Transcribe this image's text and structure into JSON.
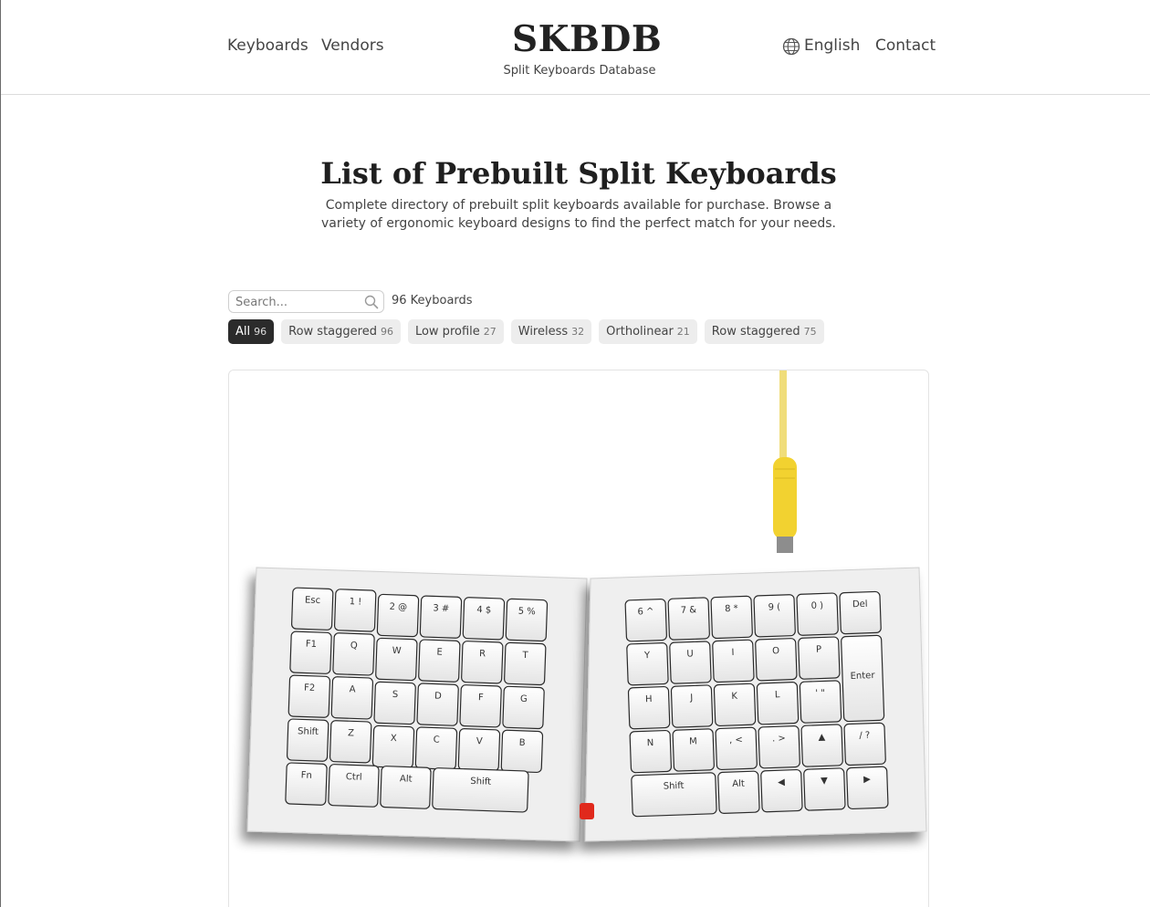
{
  "nav": {
    "keyboards": "Keyboards",
    "vendors": "Vendors",
    "language": "English",
    "contact": "Contact"
  },
  "brand": {
    "name": "SKBDB",
    "tagline": "Split Keyboards Database"
  },
  "page": {
    "title": "List of Prebuilt Split Keyboards",
    "description": "Complete directory of prebuilt split keyboards available for purchase. Browse a variety of ergonomic keyboard designs to find the perfect match for your needs."
  },
  "search": {
    "placeholder": "Search...",
    "value": ""
  },
  "result_count": "96 Keyboards",
  "filters": [
    {
      "label": "All",
      "count": "96",
      "active": true
    },
    {
      "label": "Row staggered",
      "count": "96",
      "active": false
    },
    {
      "label": "Low profile",
      "count": "27",
      "active": false
    },
    {
      "label": "Wireless",
      "count": "32",
      "active": false
    },
    {
      "label": "Ortholinear",
      "count": "21",
      "active": false
    },
    {
      "label": "Row staggered",
      "count": "75",
      "active": false
    }
  ],
  "keyboard_image": {
    "left_keys": [
      "Esc",
      "1 !",
      "2 @",
      "3 #",
      "4 $",
      "5 %",
      "F1",
      "Q",
      "W",
      "E",
      "R",
      "T",
      "F2",
      "A",
      "S",
      "D",
      "F",
      "G",
      "Shift",
      "Z",
      "X",
      "C",
      "V",
      "B",
      "Fn",
      "Ctrl",
      "Alt",
      "Shift"
    ],
    "right_keys": [
      "6 ^",
      "7 &",
      "8 *",
      "9 (",
      "0 )",
      "Del",
      "Y",
      "U",
      "I",
      "O",
      "P",
      "Enter",
      "H",
      "J",
      "K",
      "L",
      "' \"",
      "N",
      "M",
      ", <",
      ". >",
      "▲",
      "/ ?",
      "Shift",
      "Alt",
      "◀",
      "▼",
      "▶"
    ],
    "cable_color": "#f2d230"
  },
  "colors": {
    "accent_dark": "#2b2b2b",
    "chip_bg": "#ededed",
    "border": "#dcdcdc"
  }
}
